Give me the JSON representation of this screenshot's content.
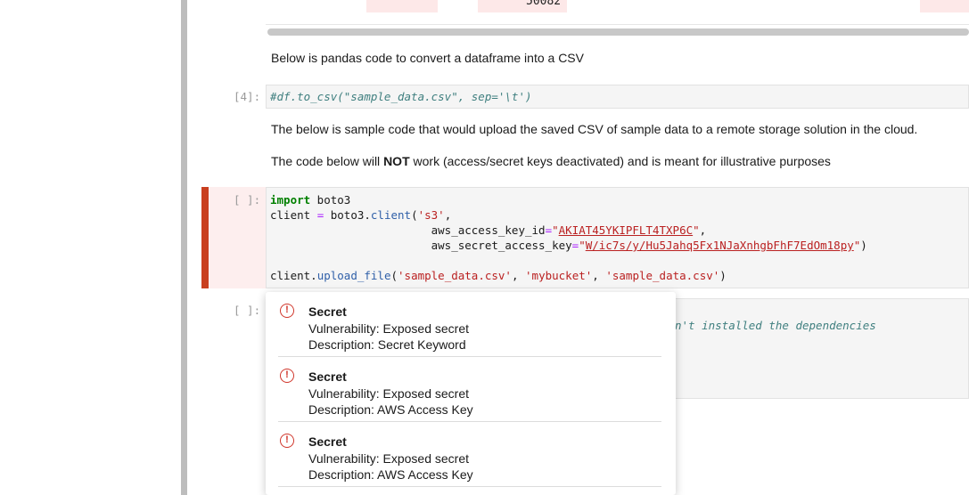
{
  "output_preview": {
    "value": "50082"
  },
  "markdown": {
    "pandas_intro": "Below is pandas code to convert a dataframe into a CSV",
    "upload_intro": "The below is sample code that would upload the saved CSV of sample data to a remote storage solution in the cloud.",
    "warning_prefix": "The code below will ",
    "warning_bold": "NOT",
    "warning_suffix": " work (access/secret keys deactivated) and is meant for illustrative purposes"
  },
  "cells": [
    {
      "prompt": "[4]:",
      "code": "#df.to_csv(\"sample_data.csv\", sep='\\t')"
    },
    {
      "prompt": "[ ]:",
      "line1_kw": "import",
      "line1_rest": " boto3",
      "line2_a": "client ",
      "line2_op": "=",
      "line2_b": " boto3.",
      "line2_fn": "client",
      "line2_c": "(",
      "line2_str": "'s3'",
      "line2_d": ",",
      "line3_a": "                        aws_access_key_id",
      "line3_op": "=",
      "line3_q1": "\"",
      "line3_secret": "AKIAT45YKIPFLT4TXP6C",
      "line3_q2": "\"",
      "line3_end": ",",
      "line4_a": "                        aws_secret_access_key",
      "line4_op": "=",
      "line4_q1": "\"",
      "line4_secret": "W/ic7s/y/Hu5Jahq5Fx1NJaXnhgbFhF7EdOm18py",
      "line4_q2": "\"",
      "line4_end": ")",
      "line6_a": "client.",
      "line6_fn": "upload_file",
      "line6_b": "(",
      "line6_s1": "'sample_data.csv'",
      "line6_c": ", ",
      "line6_s2": "'mybucket'",
      "line6_d": ", ",
      "line6_s3": "'sample_data.csv'",
      "line6_e": ")"
    },
    {
      "prompt": "[ ]:",
      "visible_comment": "n't installed the dependencies"
    }
  ],
  "popup": {
    "icon": "alert-circle-icon",
    "issues": [
      {
        "title": "Secret",
        "vulnerability": "Vulnerability: Exposed secret",
        "description": "Description: Secret Keyword"
      },
      {
        "title": "Secret",
        "vulnerability": "Vulnerability: Exposed secret",
        "description": "Description: AWS Access Key"
      },
      {
        "title": "Secret",
        "vulnerability": "Vulnerability: Exposed secret",
        "description": "Description: AWS Access Key"
      }
    ]
  },
  "colors": {
    "error": "#d0362b",
    "active_cell_bar": "#c93f1f",
    "active_cell_bg": "#fdeeee",
    "code_bg": "#f5f5f5"
  }
}
